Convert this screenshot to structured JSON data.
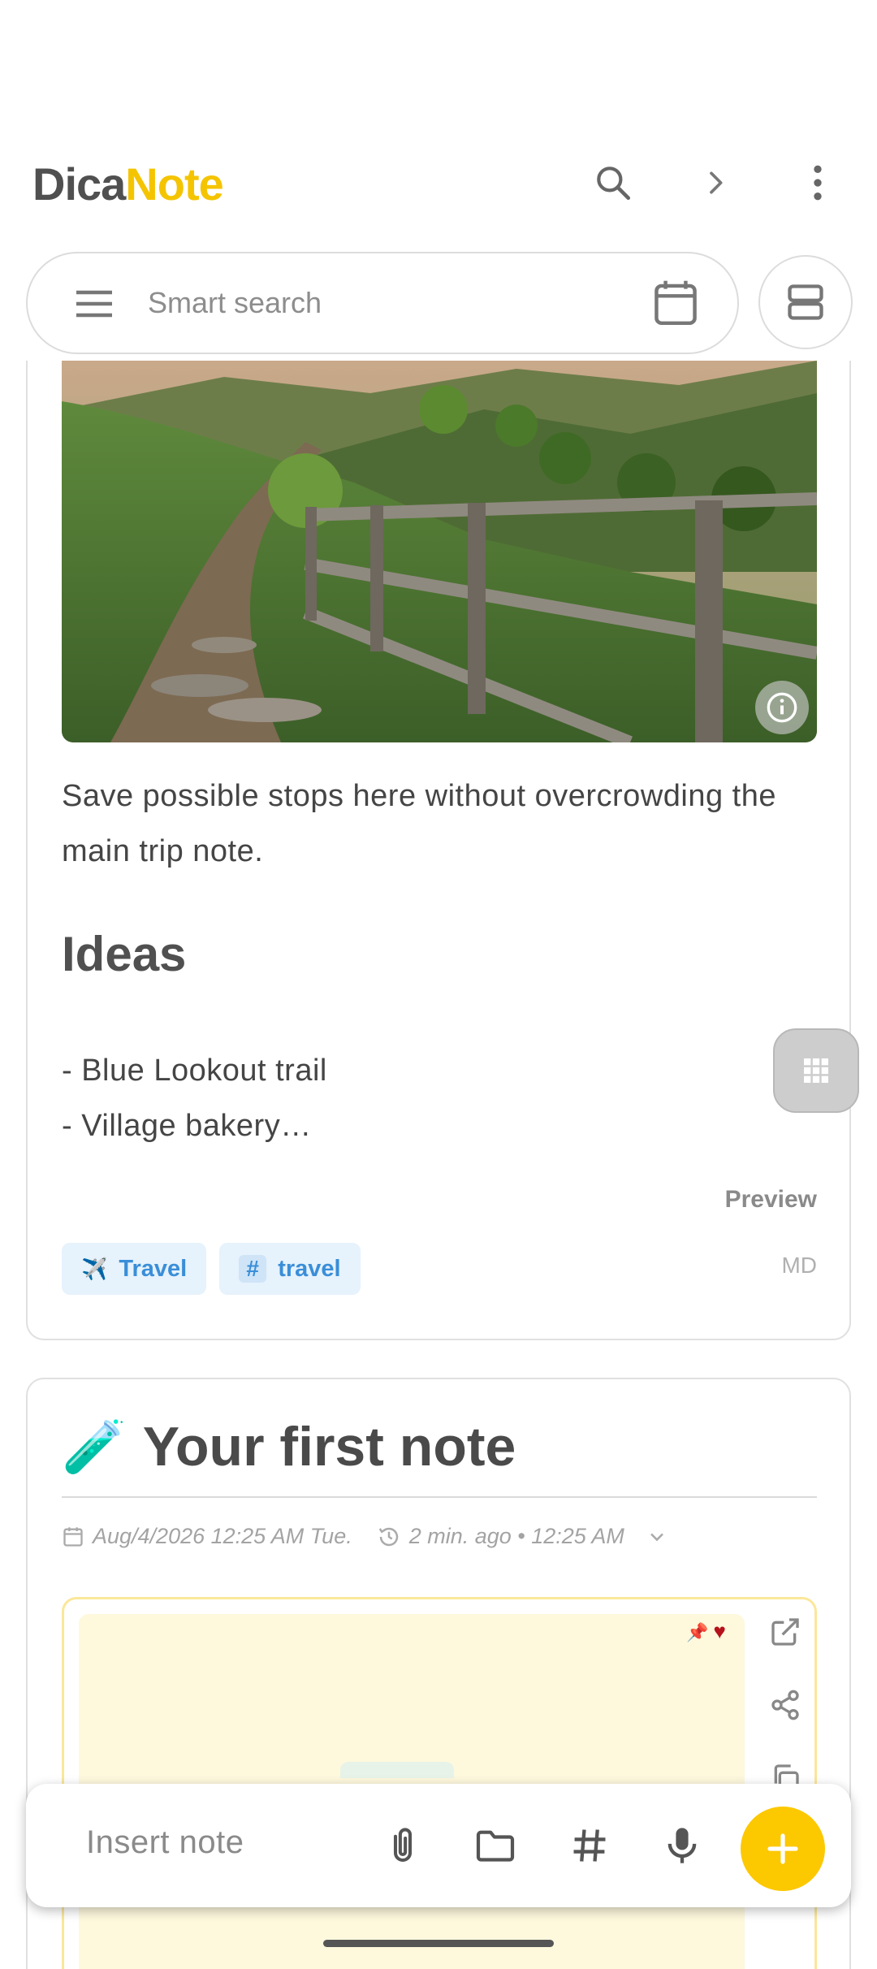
{
  "app": {
    "logo_part1": "Dica",
    "logo_part2": "Note",
    "brand_color": "#f5c400"
  },
  "header": {
    "icons": [
      "search-icon",
      "chevron-right-icon",
      "more-vert-icon"
    ]
  },
  "search": {
    "placeholder": "Smart search",
    "icons": [
      "menu-icon",
      "calendar-icon",
      "view-toggle-icon"
    ]
  },
  "note1": {
    "image_icon": "info-icon",
    "description": "Save possible stops here without overcrowding the main trip note.",
    "heading": "Ideas",
    "list": [
      "- Blue Lookout trail",
      "- Village bakery…"
    ],
    "preview_label": "Preview",
    "tags": [
      {
        "icon": "✈️",
        "label": "Travel"
      },
      {
        "icon": "#",
        "label": "travel"
      }
    ],
    "format": "MD",
    "chip_color": "#3a8ed8"
  },
  "note2": {
    "emoji": "🧪",
    "title": "Your first note",
    "date": "Aug/4/2026 12:25 AM Tue.",
    "updated": "2 min. ago • 12:25 AM",
    "pin_icon": "📌",
    "heart_icon": "♥",
    "side_icons": [
      "open-external-icon",
      "share-icon",
      "copy-icon"
    ]
  },
  "bottombar": {
    "placeholder": "Insert note",
    "icons": [
      "attach-icon",
      "folder-icon",
      "hashtag-icon",
      "mic-icon",
      "add-icon"
    ],
    "fab_color": "#fcc800"
  }
}
